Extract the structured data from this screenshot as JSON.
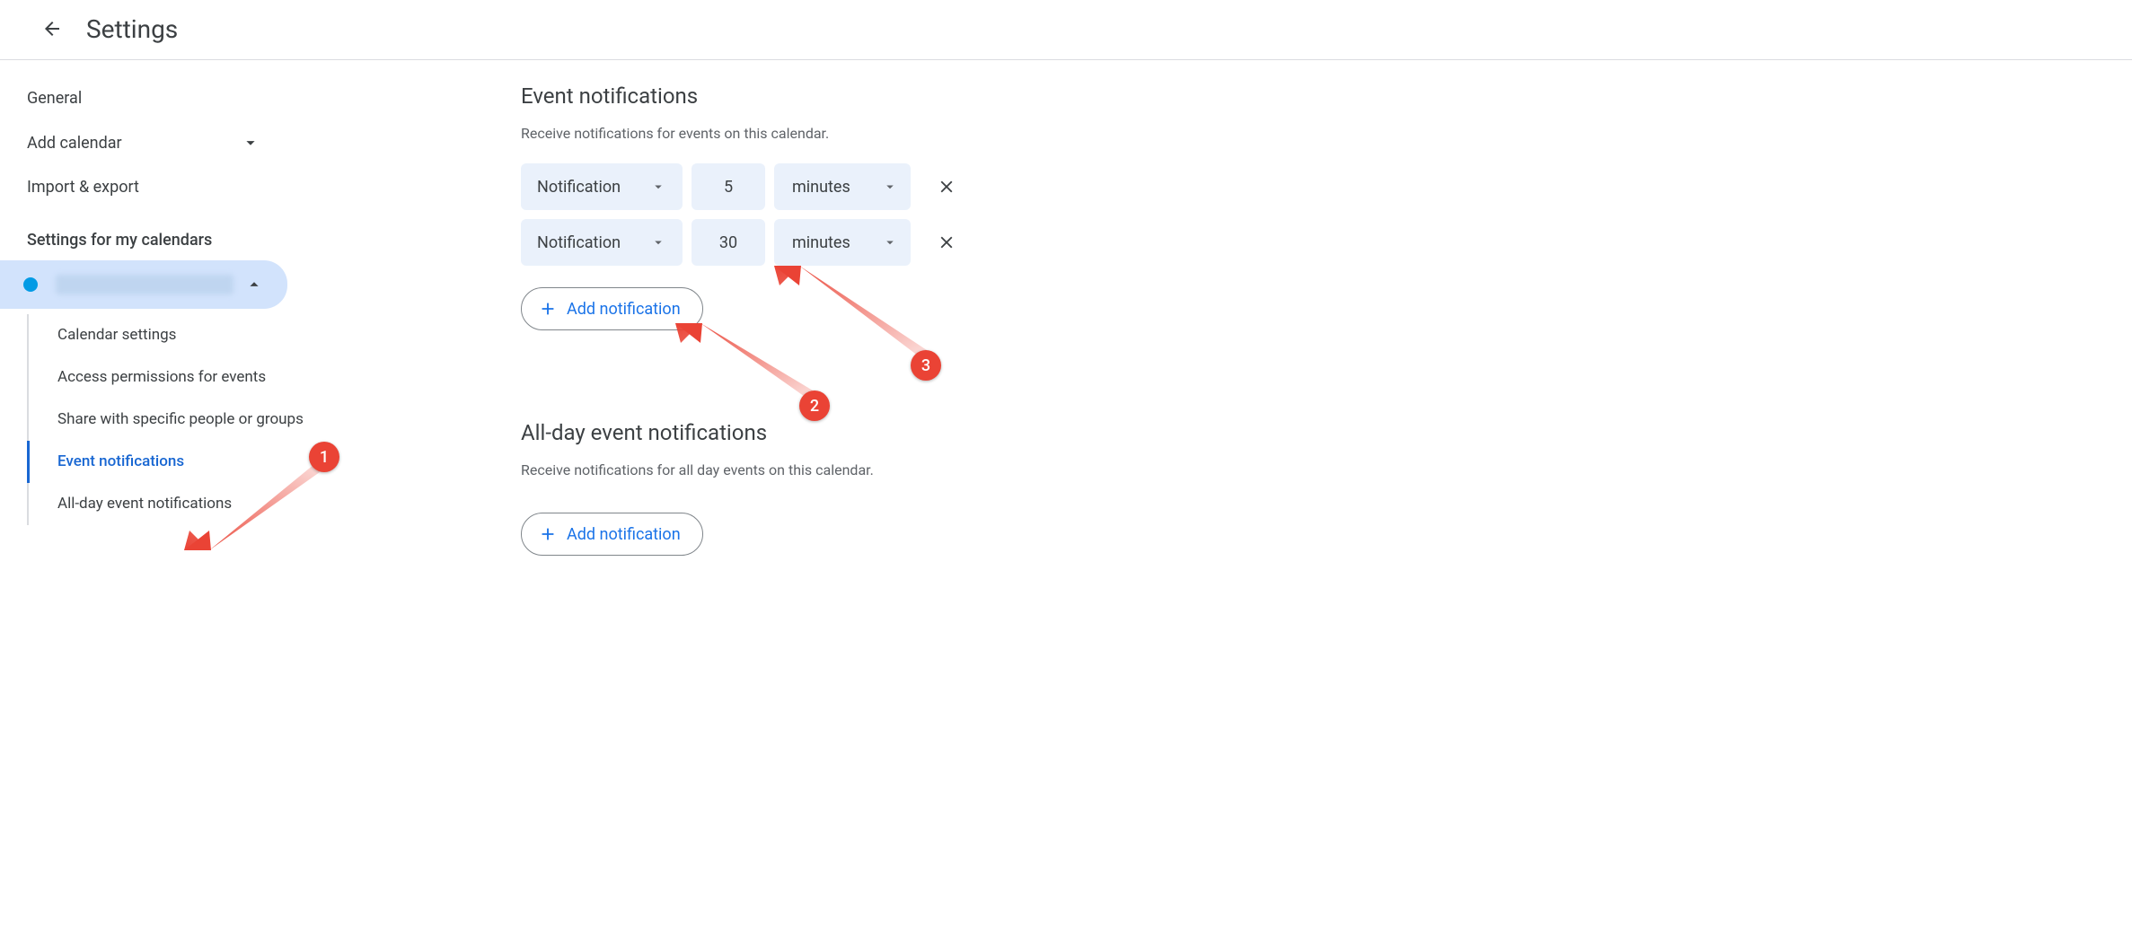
{
  "header": {
    "title": "Settings"
  },
  "sidebar": {
    "general": "General",
    "add_calendar": "Add calendar",
    "import_export": "Import & export",
    "my_calendars_heading": "Settings for my calendars",
    "subnav": {
      "calendar_settings": "Calendar settings",
      "access_permissions": "Access permissions for events",
      "share": "Share with specific people or groups",
      "event_notifications": "Event notifications",
      "allday_notifications": "All-day event notifications"
    }
  },
  "content": {
    "event_notifications": {
      "title": "Event notifications",
      "desc": "Receive notifications for events on this calendar.",
      "rows": [
        {
          "type": "Notification",
          "value": "5",
          "unit": "minutes"
        },
        {
          "type": "Notification",
          "value": "30",
          "unit": "minutes"
        }
      ],
      "add_label": "Add notification"
    },
    "allday": {
      "title": "All-day event notifications",
      "desc": "Receive notifications for all day events on this calendar.",
      "add_label": "Add notification"
    }
  },
  "annotations": {
    "a1": "1",
    "a2": "2",
    "a3": "3"
  }
}
